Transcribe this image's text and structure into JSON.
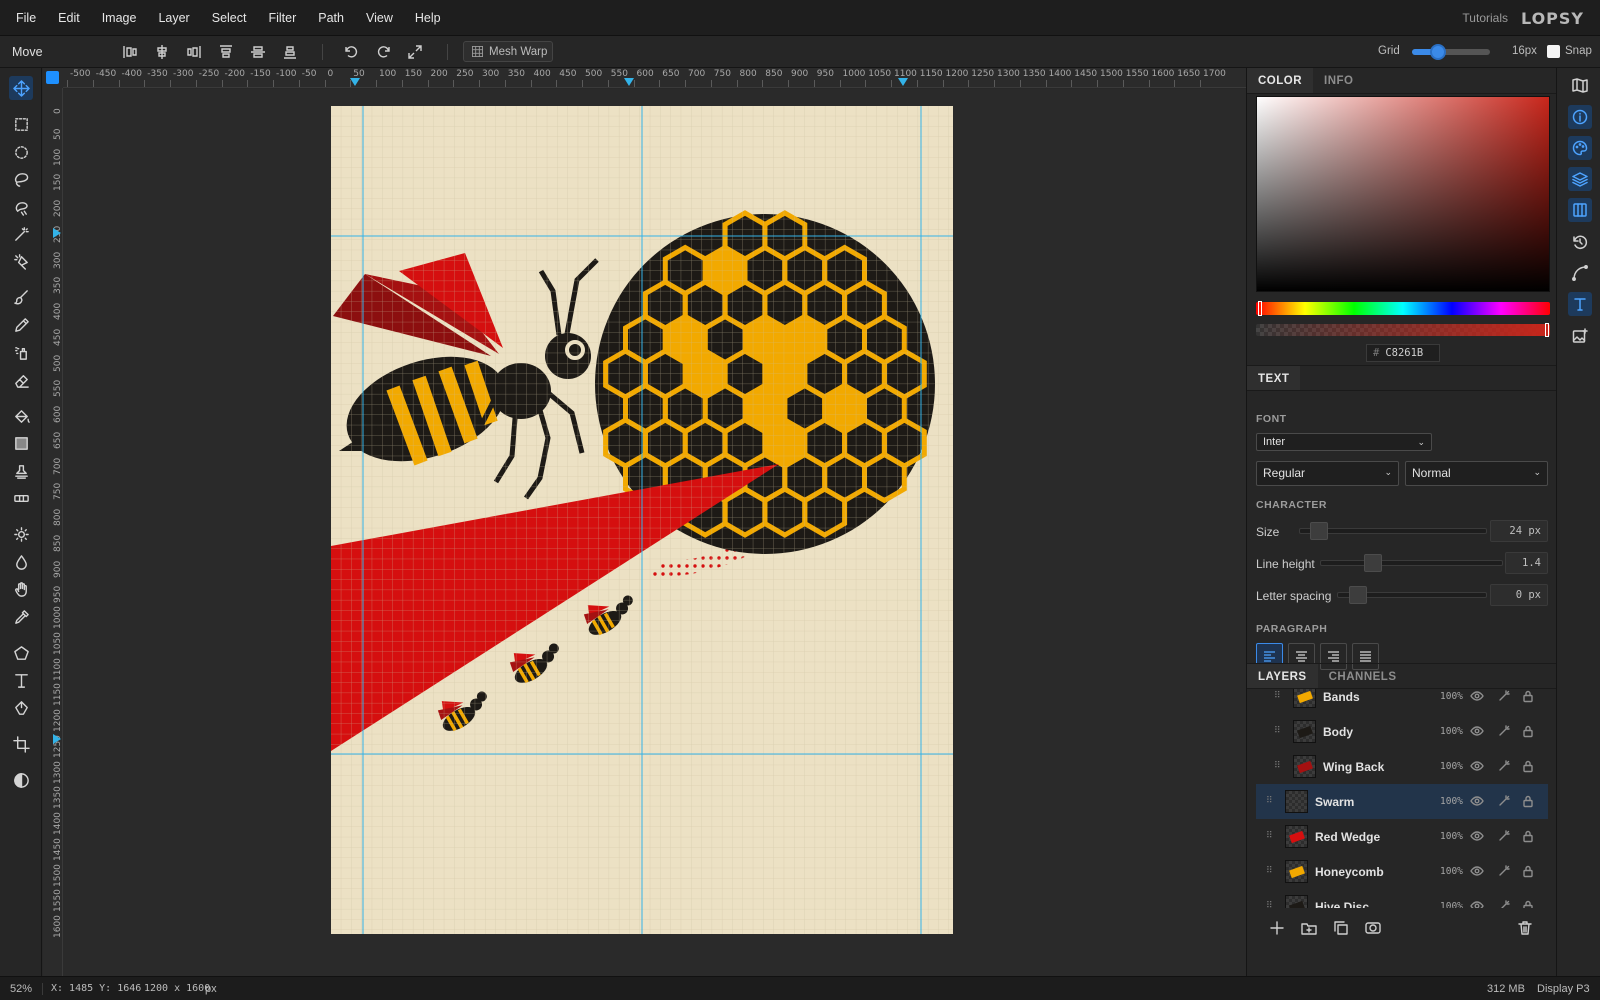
{
  "menu": {
    "items": [
      "File",
      "Edit",
      "Image",
      "Layer",
      "Select",
      "Filter",
      "Path",
      "View",
      "Help"
    ],
    "tutorials": "Tutorials",
    "logo": "LOPSY"
  },
  "options": {
    "tool_name": "Move",
    "mesh_warp": "Mesh Warp",
    "grid_label": "Grid",
    "grid_value": "16px",
    "grid_slider_fraction": 0.33,
    "snap_label": "Snap",
    "snap_checked": false
  },
  "tools": {
    "active": "move-tool",
    "items": [
      "move-tool",
      "rect-select-tool",
      "ellipse-select-tool",
      "lasso-tool",
      "magnetic-lasso-tool",
      "magic-wand-tool",
      "quick-select-tool",
      "brush-tool",
      "pencil-tool",
      "spray-tool",
      "eraser-tool",
      "fill-tool",
      "gradient-tool",
      "stamp-tool",
      "heal-tool",
      "dodge-tool",
      "burn-tool",
      "smudge-tool",
      "eyedropper-tool",
      "shape-tool",
      "text-tool",
      "pen-tool",
      "crop-tool",
      "mask-toggle"
    ]
  },
  "rulers": {
    "horizontal": [
      "-500",
      "-450",
      "-400",
      "-350",
      "-300",
      "-250",
      "-200",
      "-150",
      "-100",
      "-50",
      "0",
      "50",
      "100",
      "150",
      "200",
      "250",
      "300",
      "350",
      "400",
      "450",
      "500",
      "550",
      "600",
      "650",
      "700",
      "750",
      "800",
      "850",
      "900",
      "950",
      "1000",
      "1050",
      "1100",
      "1150",
      "1200",
      "1250",
      "1300",
      "1350",
      "1400",
      "1450",
      "1500",
      "1550",
      "1600",
      "1650",
      "1700"
    ],
    "vertical": [
      "0",
      "50",
      "100",
      "150",
      "200",
      "250",
      "300",
      "350",
      "400",
      "450",
      "500",
      "550",
      "600",
      "650",
      "700",
      "750",
      "800",
      "850",
      "900",
      "950",
      "1000",
      "1050",
      "1100",
      "1150",
      "1200",
      "1250",
      "1300",
      "1350",
      "1400",
      "1450",
      "1500",
      "1550",
      "1600"
    ]
  },
  "color_panel": {
    "tabs": [
      "COLOR",
      "INFO"
    ],
    "active_tab": "COLOR",
    "hex_prefix": "#",
    "hex": "C8261B",
    "current_color": "#c8261b"
  },
  "text_panel": {
    "tab": "TEXT",
    "font_label": "FONT",
    "font": "Inter",
    "weight": "Regular",
    "style": "Normal",
    "character_label": "CHARACTER",
    "size_label": "Size",
    "size_value": "24 px",
    "line_height_label": "Line height",
    "line_height_value": "1.4",
    "letter_spacing_label": "Letter spacing",
    "letter_spacing_value": "0 px",
    "paragraph_label": "PARAGRAPH",
    "alignment": "left"
  },
  "layers_panel": {
    "tabs": [
      "LAYERS",
      "CHANNELS"
    ],
    "active_tab": "LAYERS",
    "layers": [
      {
        "name": "Bands",
        "opacity": "100%"
      },
      {
        "name": "Body",
        "opacity": "100%"
      },
      {
        "name": "Wing Back",
        "opacity": "100%"
      },
      {
        "name": "Swarm",
        "opacity": "100%",
        "selected": true
      },
      {
        "name": "Red Wedge",
        "opacity": "100%"
      },
      {
        "name": "Honeycomb",
        "opacity": "100%"
      },
      {
        "name": "Hive Disc",
        "opacity": "100%"
      }
    ]
  },
  "status": {
    "zoom": "52%",
    "cursor": "X: 1485 Y: 1646",
    "doc_size": "1200 x 1600",
    "doc_unit": "px",
    "memory": "312 MB",
    "color_profile": "Display P3"
  },
  "colors": {
    "accent": "#3b8ae8",
    "artwork_bg": "#ece1c4",
    "red": "#d50f0f",
    "honey": "#f2a900",
    "ink": "#1d1a16"
  }
}
